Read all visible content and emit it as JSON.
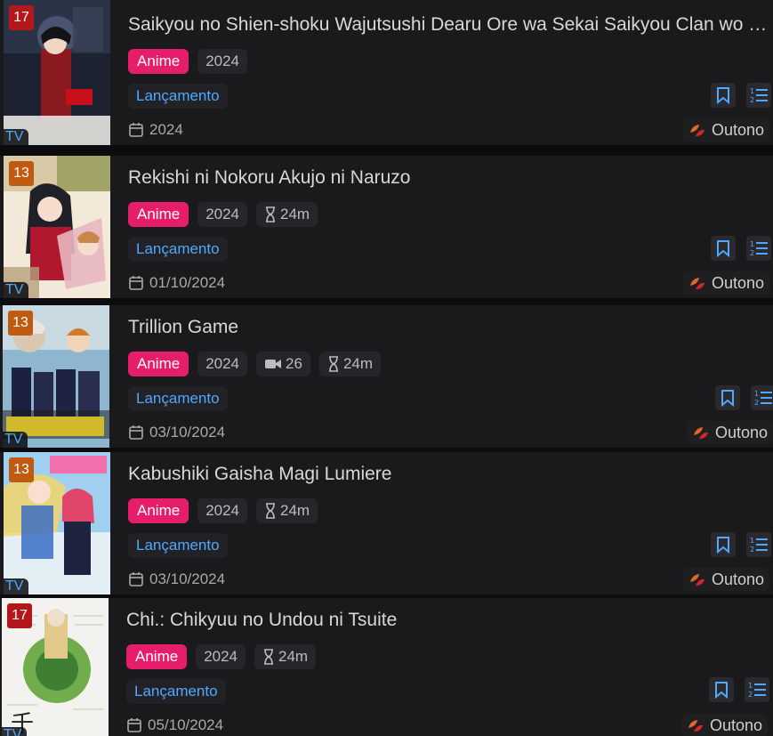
{
  "colors": {
    "anime_badge": "#e61d6a",
    "accent_blue": "#4fa8ff",
    "rating_17": "#b3171b",
    "rating_13": "#bf5a10"
  },
  "items": [
    {
      "rating": "17",
      "type": "TV",
      "title": "Saikyou no Shien-shoku Wajutsushi Dearu Ore wa Sekai Saikyou Clan wo Shitagaeru",
      "category": "Anime",
      "year": "2024",
      "episodes": "",
      "duration": "",
      "status": "Lançamento",
      "date": "2024",
      "season": "Outono"
    },
    {
      "rating": "13",
      "type": "TV",
      "title": "Rekishi ni Nokoru Akujo ni Naruzo",
      "category": "Anime",
      "year": "2024",
      "episodes": "",
      "duration": "24m",
      "status": "Lançamento",
      "date": "01/10/2024",
      "season": "Outono"
    },
    {
      "rating": "13",
      "type": "TV",
      "title": "Trillion Game",
      "category": "Anime",
      "year": "2024",
      "episodes": "26",
      "duration": "24m",
      "status": "Lançamento",
      "date": "03/10/2024",
      "season": "Outono"
    },
    {
      "rating": "13",
      "type": "TV",
      "title": "Kabushiki Gaisha Magi Lumiere",
      "category": "Anime",
      "year": "2024",
      "episodes": "",
      "duration": "24m",
      "status": "Lançamento",
      "date": "03/10/2024",
      "season": "Outono"
    },
    {
      "rating": "17",
      "type": "TV",
      "title": "Chi.: Chikyuu no Undou ni Tsuite",
      "category": "Anime",
      "year": "2024",
      "episodes": "",
      "duration": "24m",
      "status": "Lançamento",
      "date": "05/10/2024",
      "season": "Outono"
    }
  ]
}
